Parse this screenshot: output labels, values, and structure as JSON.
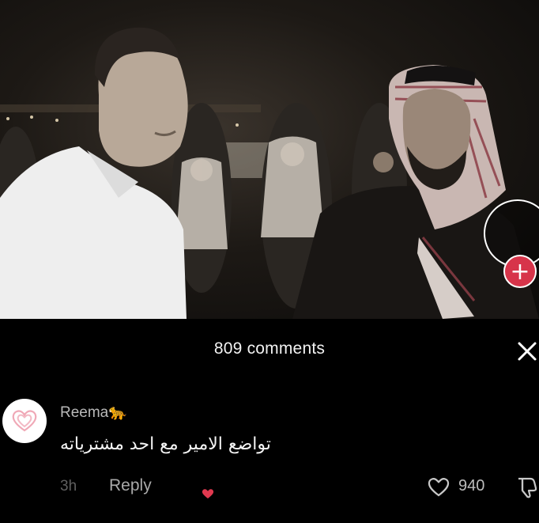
{
  "video": {
    "follow_icon": "plus-icon",
    "follow_glyph": "+",
    "accent_color": "#d7344a"
  },
  "comments_sheet": {
    "title": "809 comments",
    "close_icon": "close-icon"
  },
  "comment": {
    "avatar_icon": "heart-avatar-icon",
    "username": "Reema🐆",
    "text": "تواضع الامير مع احد مشترياته",
    "timestamp": "3h",
    "reply_label": "Reply",
    "creator_liked_icon": "heart-icon",
    "like_icon": "heart-outline-icon",
    "like_count": "940",
    "dislike_icon": "thumbs-down-icon"
  }
}
